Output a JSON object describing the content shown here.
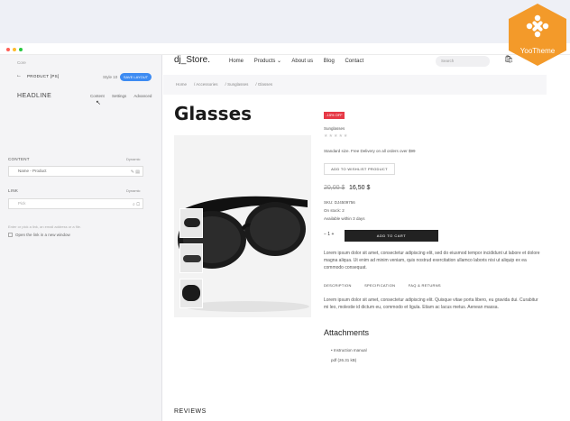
{
  "panel": {
    "crumb": "Core",
    "back_label": "PRODUCT [PS]",
    "style_label": "Style 10",
    "save_label": "SAVE LAYOUT",
    "headline": "HEADLINE",
    "tabs": [
      "Content",
      "Settings",
      "Advanced"
    ],
    "content_label": "CONTENT",
    "dynamic_label": "Dynamic",
    "content_value": "Name - Product",
    "link_label": "LINK",
    "link_placeholder": "Pick",
    "help_text": "Enter or pick a link, an email address or a file.",
    "checkbox_label": "Open the link in a new window"
  },
  "store": {
    "logo": "dj_Store.",
    "nav": [
      "Home",
      "Products ⌄",
      "About us",
      "Blog",
      "Contact"
    ],
    "search_placeholder": "Search",
    "breadcrumb": [
      "Home",
      "Accessories",
      "Sunglasses",
      "Glasses"
    ],
    "title": "Glasses",
    "sale_badge": "-15% OFF",
    "sku_label": "Sunglasses",
    "stars": "★★★★★",
    "delivery_note": "Standard size. Free Delivery on all orders over $99",
    "wish_button": "ADD TO WISHLIST PRODUCT",
    "old_price": "20,00 $",
    "price": "16,50 $",
    "sku": "SKU: DJ4509756",
    "stock": "On stock: 2",
    "availability": "Available within 3 days",
    "qty": "−  1  +",
    "cart_button": "ADD TO CART",
    "desc1": "Lorem ipsum dolor sit amet, consectetur adipiscing elit, sed do eiusmod tempor incididunt ut labore et dolore magna aliqua. Ut enim ad minim veniam, quis nostrud exercitation ullamco laboris nisi ut aliquip ex ea commodo consequat.",
    "tabs": [
      "DESCRIPTION",
      "SPECIFICATION",
      "FAQ & RETURNS"
    ],
    "desc2": "Lorem ipsum dolor sit amet, consectetur adipiscing elit. Quisque vitae porta libero, eu gravida dui. Curabitur mi leo, molestie id dictum eu, commodo et ligula. Etiam ac lacus metus. Aenean massa.",
    "attachments_title": "Attachments",
    "attachment_item": "• Instruction manual",
    "attachment_size": "pdf (26.31 kB)",
    "reviews": "REVIEWS"
  },
  "badge": {
    "label": "YooTheme",
    "color": "#f39a2a"
  }
}
